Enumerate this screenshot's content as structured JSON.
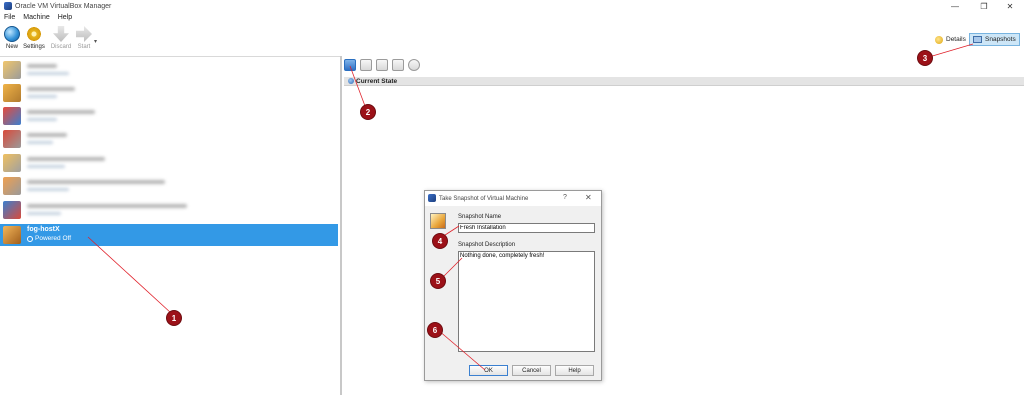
{
  "window": {
    "title": "Oracle VM VirtualBox Manager",
    "minimize": "—",
    "restore": "❐",
    "close": "✕"
  },
  "menu": [
    "File",
    "Machine",
    "Help"
  ],
  "toolbar": {
    "new_label": "New",
    "settings_label": "Settings",
    "discard_label": "Discard",
    "start_label": "Start",
    "dropdown": "▾"
  },
  "modes": {
    "details_label": "Details",
    "snapshots_label": "Snapshots"
  },
  "vm_list": {
    "selected": {
      "name": "fog-hostX",
      "state": "Powered Off"
    }
  },
  "snapshots": {
    "current_state": "Current State"
  },
  "dialog": {
    "title": "Take Snapshot of Virtual Machine",
    "help": "?",
    "close": "✕",
    "name_label": "Snapshot Name",
    "name_value": "Fresh Installation",
    "desc_label": "Snapshot Description",
    "desc_value": "Nothing done, completely fresh!",
    "ok": "OK",
    "cancel": "Cancel",
    "help_btn": "Help"
  },
  "callouts": [
    "1",
    "2",
    "3",
    "4",
    "5",
    "6"
  ],
  "colors": {
    "selection": "#3399e6",
    "callout": "#9c1118",
    "arrow": "#e0202a"
  },
  "icons": [
    "virtualbox-icon",
    "new-icon",
    "settings-gear-icon",
    "discard-icon",
    "start-arrow-icon",
    "details-icon",
    "snapshots-icon",
    "power-off-icon",
    "camera-icon"
  ]
}
